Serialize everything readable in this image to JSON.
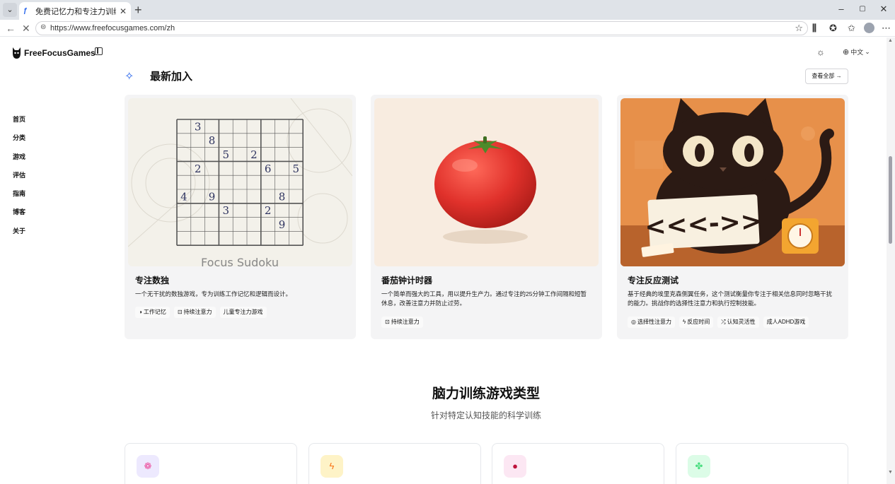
{
  "browser": {
    "tab_title": "免费记忆力和专注力训练游戏",
    "url": "https://www.freefocusgames.com/zh",
    "minimize": "–",
    "maximize": "▢",
    "close": "✕"
  },
  "header": {
    "logo_text": "FreeFocusGames",
    "language": "中文"
  },
  "nav": {
    "items": [
      {
        "label": "首页"
      },
      {
        "label": "分类"
      },
      {
        "label": "游戏"
      },
      {
        "label": "评估"
      },
      {
        "label": "指南"
      },
      {
        "label": "博客"
      },
      {
        "label": "关于"
      }
    ]
  },
  "latest": {
    "title": "最新加入",
    "view_all": "查看全部 →",
    "cards": [
      {
        "title": "专注数独",
        "description": "一个无干扰的数独游戏，专为训练工作记忆和逻辑而设计。",
        "image_caption": "Focus Sudoku",
        "tags": [
          {
            "icon": "brain-icon",
            "label": "工作记忆"
          },
          {
            "icon": "focus-icon",
            "label": "持续注意力"
          },
          {
            "icon": "",
            "label": "儿童专注力游戏"
          }
        ]
      },
      {
        "title": "番茄钟计时器",
        "description": "一个简单而强大的工具，用以提升生产力。通过专注的25分钟工作间隔和短暂休息，改善注意力并防止过劳。",
        "tags": [
          {
            "icon": "focus-icon",
            "label": "持续注意力"
          }
        ]
      },
      {
        "title": "专注反应测试",
        "description": "基于经典的埃里克森侧翼任务，这个测试衡量你专注于相关信息同时忽略干扰的能力。挑战你的选择性注意力和执行控制技能。",
        "tags": [
          {
            "icon": "target-icon",
            "label": "选择性注意力"
          },
          {
            "icon": "lightning-icon",
            "label": "反应时间"
          },
          {
            "icon": "shuffle-icon",
            "label": "认知灵活性"
          },
          {
            "icon": "",
            "label": "成人ADHD游戏"
          }
        ]
      }
    ]
  },
  "categories": {
    "title": "脑力训练游戏类型",
    "subtitle": "针对特定认知技能的科学训练",
    "cards": [
      {
        "icon": "brain-icon",
        "color": "#ede9fe"
      },
      {
        "icon": "lightning-icon",
        "color": "#fef3c7"
      },
      {
        "icon": "dot-icon",
        "color": "#fce7f3"
      },
      {
        "icon": "puzzle-icon",
        "color": "#dcfce7"
      }
    ]
  },
  "sudoku": {
    "cells": [
      {
        "r": 0,
        "c": 1,
        "v": "3"
      },
      {
        "r": 1,
        "c": 2,
        "v": "8"
      },
      {
        "r": 2,
        "c": 3,
        "v": "5"
      },
      {
        "r": 2,
        "c": 5,
        "v": "2"
      },
      {
        "r": 3,
        "c": 1,
        "v": "2"
      },
      {
        "r": 3,
        "c": 6,
        "v": "6"
      },
      {
        "r": 3,
        "c": 8,
        "v": "5"
      },
      {
        "r": 5,
        "c": 0,
        "v": "4"
      },
      {
        "r": 5,
        "c": 2,
        "v": "9"
      },
      {
        "r": 5,
        "c": 7,
        "v": "8"
      },
      {
        "r": 6,
        "c": 3,
        "v": "3"
      },
      {
        "r": 6,
        "c": 6,
        "v": "2"
      },
      {
        "r": 7,
        "c": 7,
        "v": "9"
      }
    ]
  },
  "flanker": {
    "arrows": "<<<->>"
  },
  "colors": {
    "accent": "#2563eb",
    "tomato": "#e0312b",
    "cat_bg": "#e7904a"
  }
}
